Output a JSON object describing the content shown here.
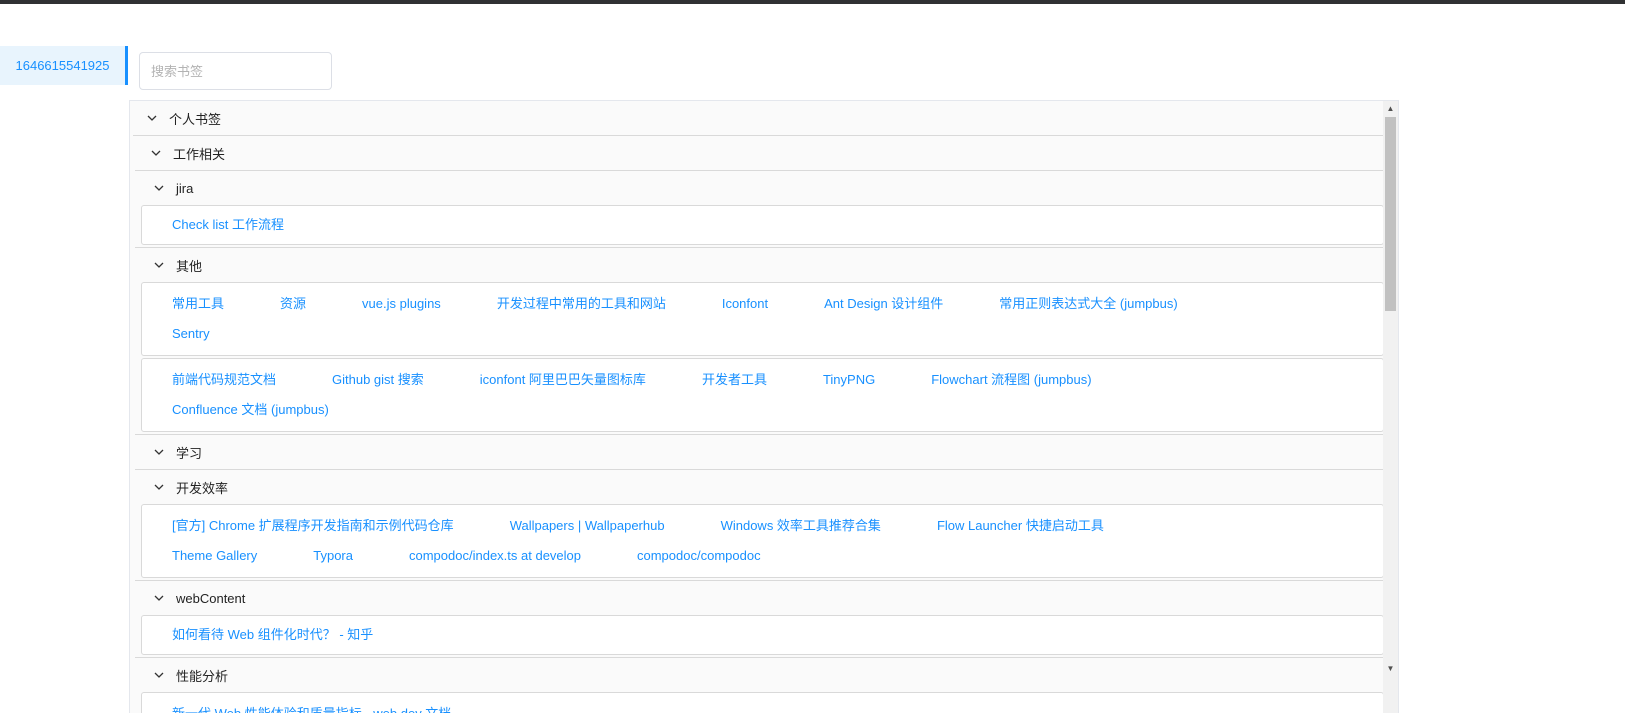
{
  "sidebar": {
    "items": [
      {
        "label": "1646615541925"
      }
    ]
  },
  "search": {
    "placeholder": "搜索书签",
    "value": ""
  },
  "tree": {
    "level1": {
      "title": "个人书签"
    },
    "level2": {
      "title": "工作相关"
    },
    "jira": {
      "title": "jira",
      "links": [
        "Check list 工作流程"
      ]
    },
    "misc": {
      "title": "其他",
      "row1": [
        "常用工具",
        "资源",
        "vue.js plugins",
        "开发过程中常用的工具和网站",
        "Iconfont",
        "Ant Design 设计组件",
        "常用正则表达式大全 (jumpbus)"
      ],
      "row2": [
        "Sentry"
      ],
      "row3": [
        "前端代码规范文档",
        "Github gist 搜索",
        "iconfont 阿里巴巴矢量图标库",
        "开发者工具",
        "TinyPNG",
        "Flowchart 流程图 (jumpbus)"
      ],
      "row4": [
        "Confluence 文档 (jumpbus)"
      ]
    },
    "study": {
      "title": "学习"
    },
    "productivity": {
      "title": "开发效率",
      "row1": [
        "[官方] Chrome 扩展程序开发指南和示例代码仓库",
        "Wallpapers | Wallpaperhub",
        "Windows 效率工具推荐合集",
        "Flow Launcher 快捷启动工具"
      ],
      "row2": [
        "Theme Gallery",
        "Typora",
        "compodoc/index.ts at develop",
        "compodoc/compodoc"
      ]
    },
    "webContent": {
      "title": "webContent",
      "links": [
        "如何看待 Web 组件化时代？ - 知乎"
      ]
    },
    "perf": {
      "title": "性能分析",
      "links": [
        "新一代 Web 性能体验和质量指标 - web.dev 文档"
      ]
    }
  }
}
